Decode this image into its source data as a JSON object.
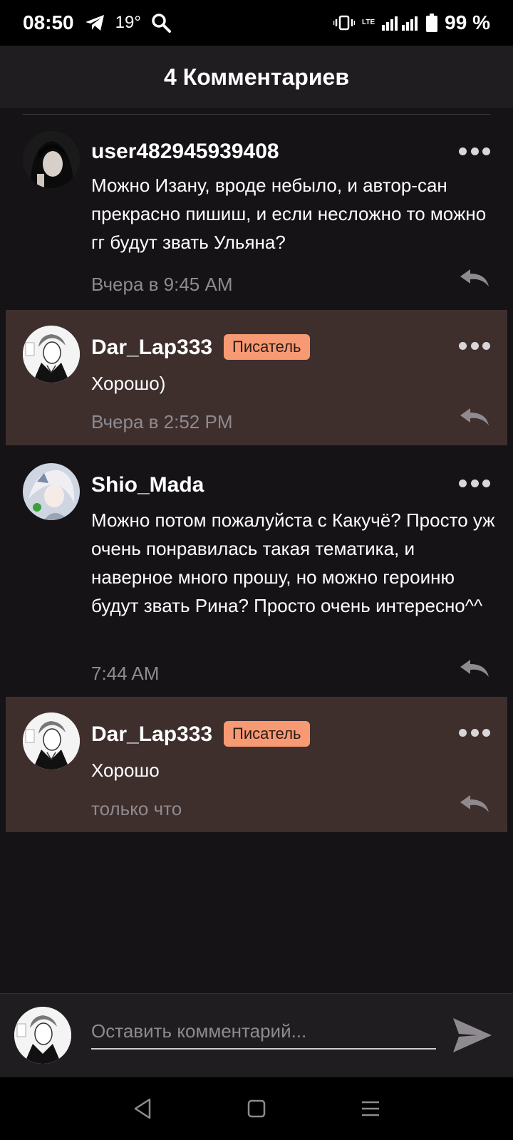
{
  "status_bar": {
    "time": "08:50",
    "temperature": "19°",
    "lte": "LTE",
    "battery": "99 %"
  },
  "header": {
    "title": "4 Комментариев"
  },
  "comments": [
    {
      "username": "user482945939408",
      "badge": "",
      "text": "Можно Изану, вроде небыло, и автор-сан прекрасно пишиш, и если несложно то можно гг будут звать Ульяна?",
      "time": "Вчера в 9:45 AM"
    },
    {
      "username": "Dar_Lap333",
      "badge": "Писатель",
      "text": "Хорошо)",
      "time": "Вчера в 2:52 PM"
    },
    {
      "username": "Shio_Mada",
      "badge": "",
      "text": "Можно потом пожалуйста с Какучё? Просто уж очень понравилась такая тематика, и наверное много прошу, но можно героиню будут звать Рина? Просто очень интересно^^",
      "time": "7:44 AM"
    },
    {
      "username": "Dar_Lap333",
      "badge": "Писатель",
      "text": "Хорошо",
      "time": "только что"
    }
  ],
  "input": {
    "placeholder": "Оставить комментарий..."
  },
  "colors": {
    "writer_bg": "#3e2f2d",
    "badge_bg": "#f79a73"
  }
}
